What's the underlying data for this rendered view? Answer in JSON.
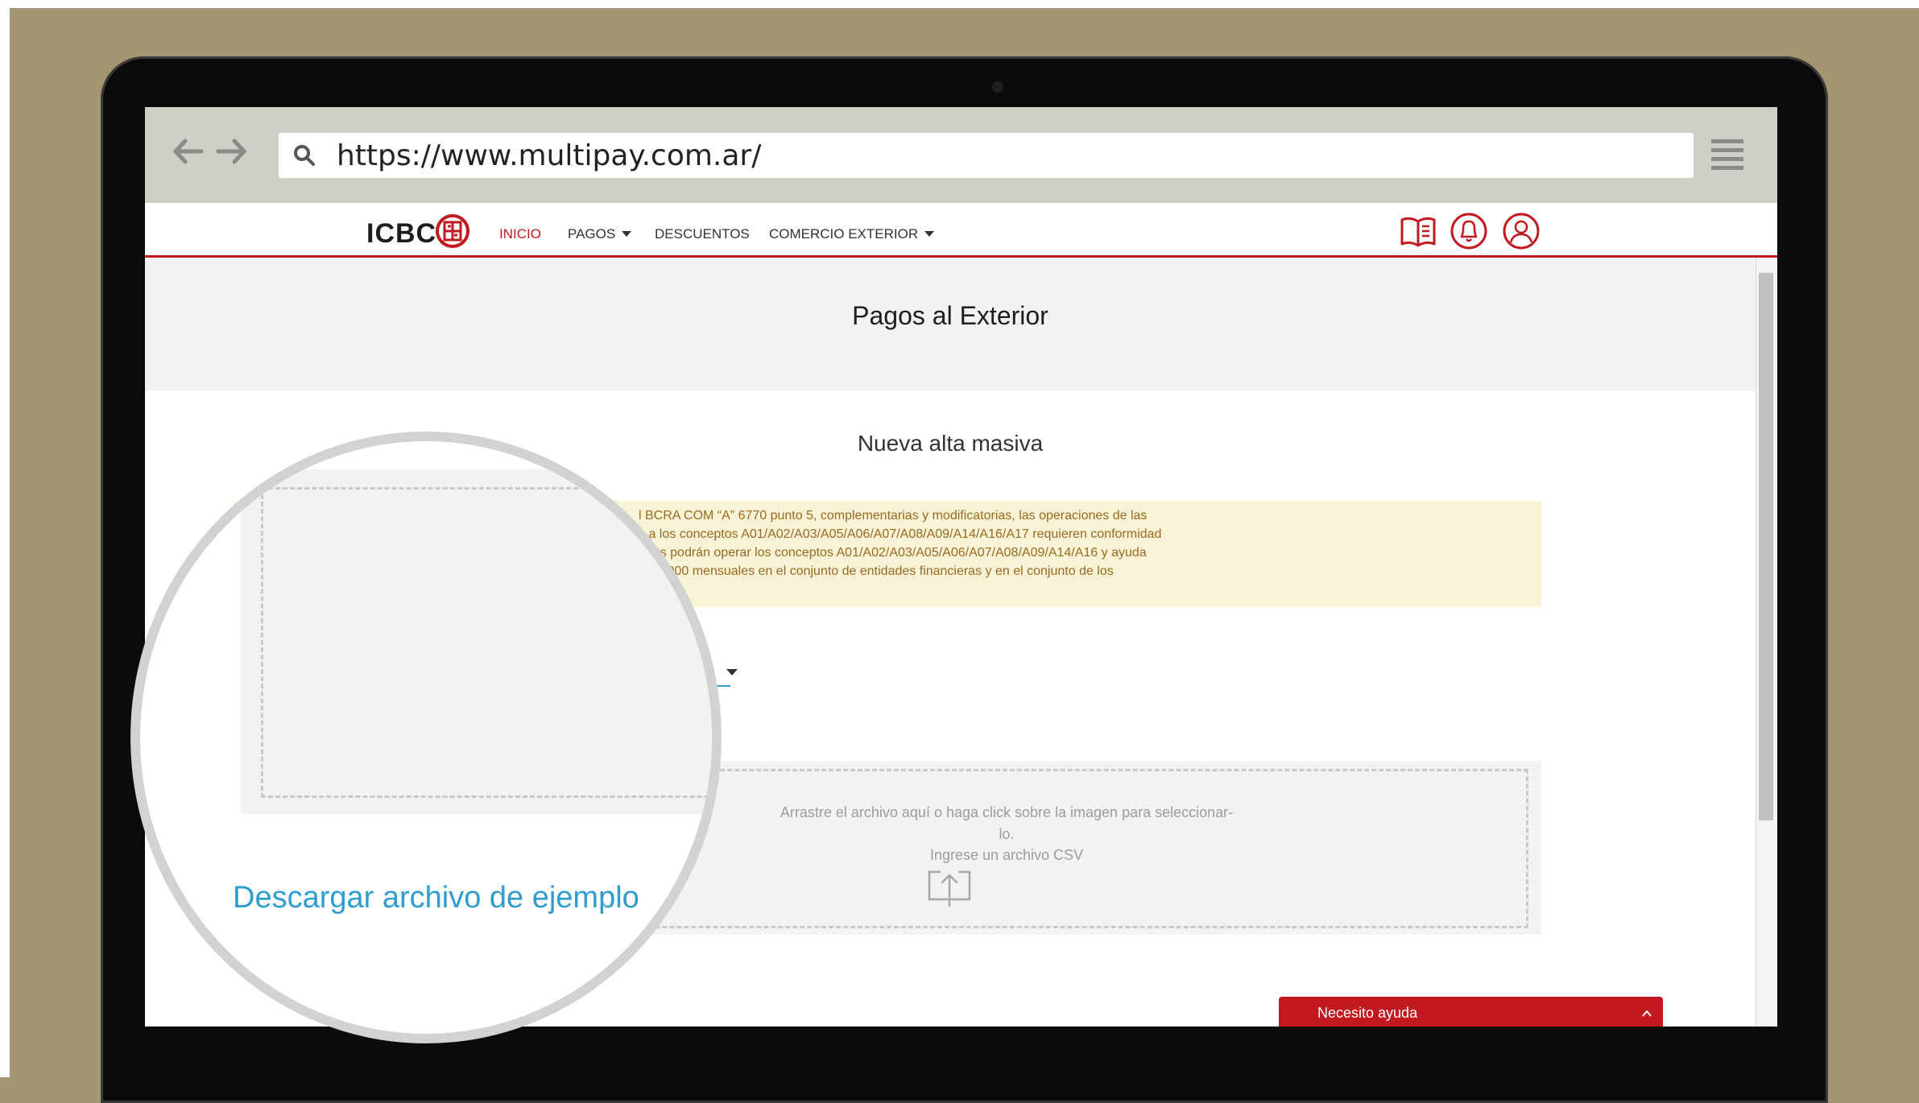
{
  "browser": {
    "url": "https://www.multipay.com.ar/"
  },
  "header": {
    "logo_text": "ICBC",
    "nav": [
      {
        "label": "INICIO"
      },
      {
        "label": "PAGOS"
      },
      {
        "label": "DESCUENTOS"
      },
      {
        "label": "COMERCIO EXTERIOR"
      }
    ]
  },
  "page": {
    "title": "Pagos al Exterior",
    "subtitle": "Nueva alta masiva"
  },
  "warning": {
    "lines": [
      "l BCRA COM “A” 6770 punto 5, complementarias y modificatorias, las operaciones de las",
      "s a los conceptos A01/A02/A03/A05/A06/A07/A08/A09/A14/A16/A17 requieren conformidad",
      "anas podrán operar los conceptos A01/A02/A03/A05/A06/A07/A08/A09/A14/A16 y ayuda",
      "$ 10.000 mensuales en el conjunto de entidades financieras y en el conjunto de los"
    ]
  },
  "upload": {
    "instruction_1": "Arrastre el archivo aquí o haga click sobre la imagen para seleccionar-",
    "instruction_2": "lo.",
    "hint": "Ingrese un archivo CSV"
  },
  "magnifier": {
    "link": "Descargar archivo de ejemplo"
  },
  "help": {
    "label": "Necesito ayuda"
  },
  "colors": {
    "accent": "#c2181f",
    "link": "#2f9dcf",
    "warning_bg": "#f8f2d6",
    "warning_text": "#9a6a1f"
  }
}
